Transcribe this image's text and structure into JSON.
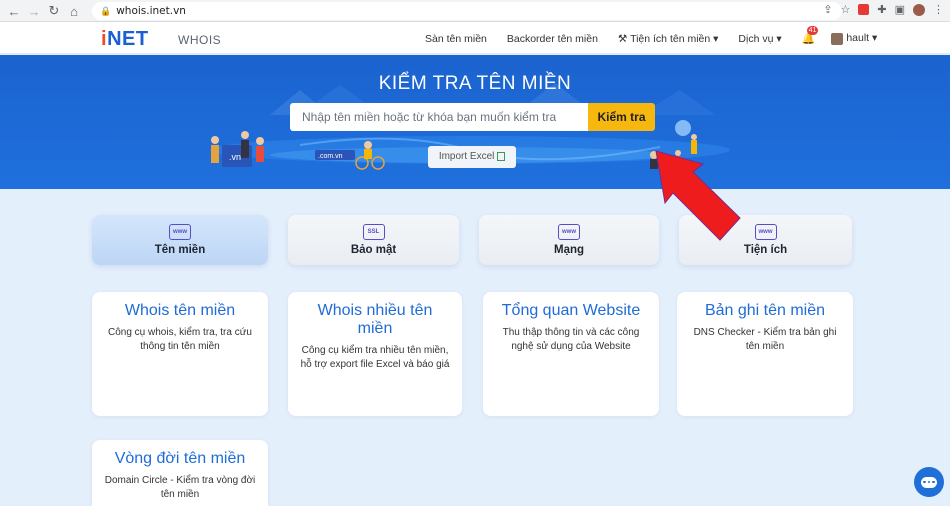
{
  "browser": {
    "url": "whois.inet.vn"
  },
  "header": {
    "logo_i": "i",
    "logo_rest": "NET",
    "section": "WHOIS",
    "menu": [
      {
        "label": "Sàn tên miền"
      },
      {
        "label": "Backorder tên miền"
      },
      {
        "label": "⚒ Tiện ích tên miền ▾"
      },
      {
        "label": "Dịch vụ ▾"
      }
    ],
    "notification_count": "41",
    "user": "hault ▾"
  },
  "hero": {
    "title": "KIỂM TRA TÊN MIỀN",
    "search_placeholder": "Nhập tên miền hoặc từ khóa bạn muốn kiểm tra",
    "search_button": "Kiểm tra",
    "import_button": "Import Excel",
    "illus_vn": ".vn",
    "illus_com": ".com.vn"
  },
  "tabs": [
    {
      "label": "Tên miền",
      "icon": "www-search-icon",
      "icon_text": "www",
      "active": true
    },
    {
      "label": "Bảo mật",
      "icon": "security-check-icon",
      "icon_text": "SSL",
      "active": false
    },
    {
      "label": "Mạng",
      "icon": "www-ip-icon",
      "icon_text": "www",
      "active": false
    },
    {
      "label": "Tiện ích",
      "icon": "www-tools-icon",
      "icon_text": "www",
      "active": false
    }
  ],
  "cards": [
    {
      "title": "Whois tên miền",
      "desc": "Công cụ whois, kiểm tra, tra cứu thông tin tên miền"
    },
    {
      "title": "Whois nhiều tên miền",
      "desc": "Công cụ kiểm tra nhiều tên miền, hỗ trợ export file Excel và báo giá"
    },
    {
      "title": "Tổng quan Website",
      "desc": "Thu thập thông tin và các công nghệ sử dụng của Website"
    },
    {
      "title": "Bản ghi tên miền",
      "desc": "DNS Checker - Kiểm tra bản ghi tên miền"
    },
    {
      "title": "Vòng đời tên miền",
      "desc": "Domain Circle - Kiểm tra vòng đời tên miền"
    }
  ],
  "colors": {
    "brand_blue": "#1f6cd6",
    "hero_blue": "#1b63cf",
    "search_button": "#f6b80f",
    "annotation_arrow": "#ee1c1c"
  }
}
